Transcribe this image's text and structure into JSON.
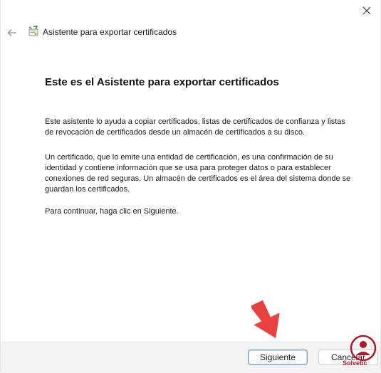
{
  "header": {
    "title": "Asistente para exportar certificados",
    "back_icon": "back-arrow-icon",
    "wizard_icon": "certificate-wizard-icon"
  },
  "window": {
    "close_icon": "close-icon"
  },
  "main": {
    "heading": "Este es el Asistente para exportar certificados",
    "paragraph1": "Este asistente lo ayuda a copiar certificados, listas de certificados de confianza y listas de revocación de certificados desde un almacén de certificados a su disco.",
    "paragraph2": "Un certificado, que lo emite una entidad de certificación, es una confirmación de su identidad y contiene información que se usa para proteger datos o para establecer conexiones de red seguras. Un almacén de certificados es el área del sistema donde se guardan los certificados.",
    "paragraph3": "Para continuar, haga clic en Siguiente."
  },
  "footer": {
    "next_label": "Siguiente",
    "cancel_label": "Cancelar"
  },
  "overlay": {
    "arrow_color": "#e8413f",
    "watermark_text": "Solvetic",
    "watermark_color": "#b0192b"
  }
}
